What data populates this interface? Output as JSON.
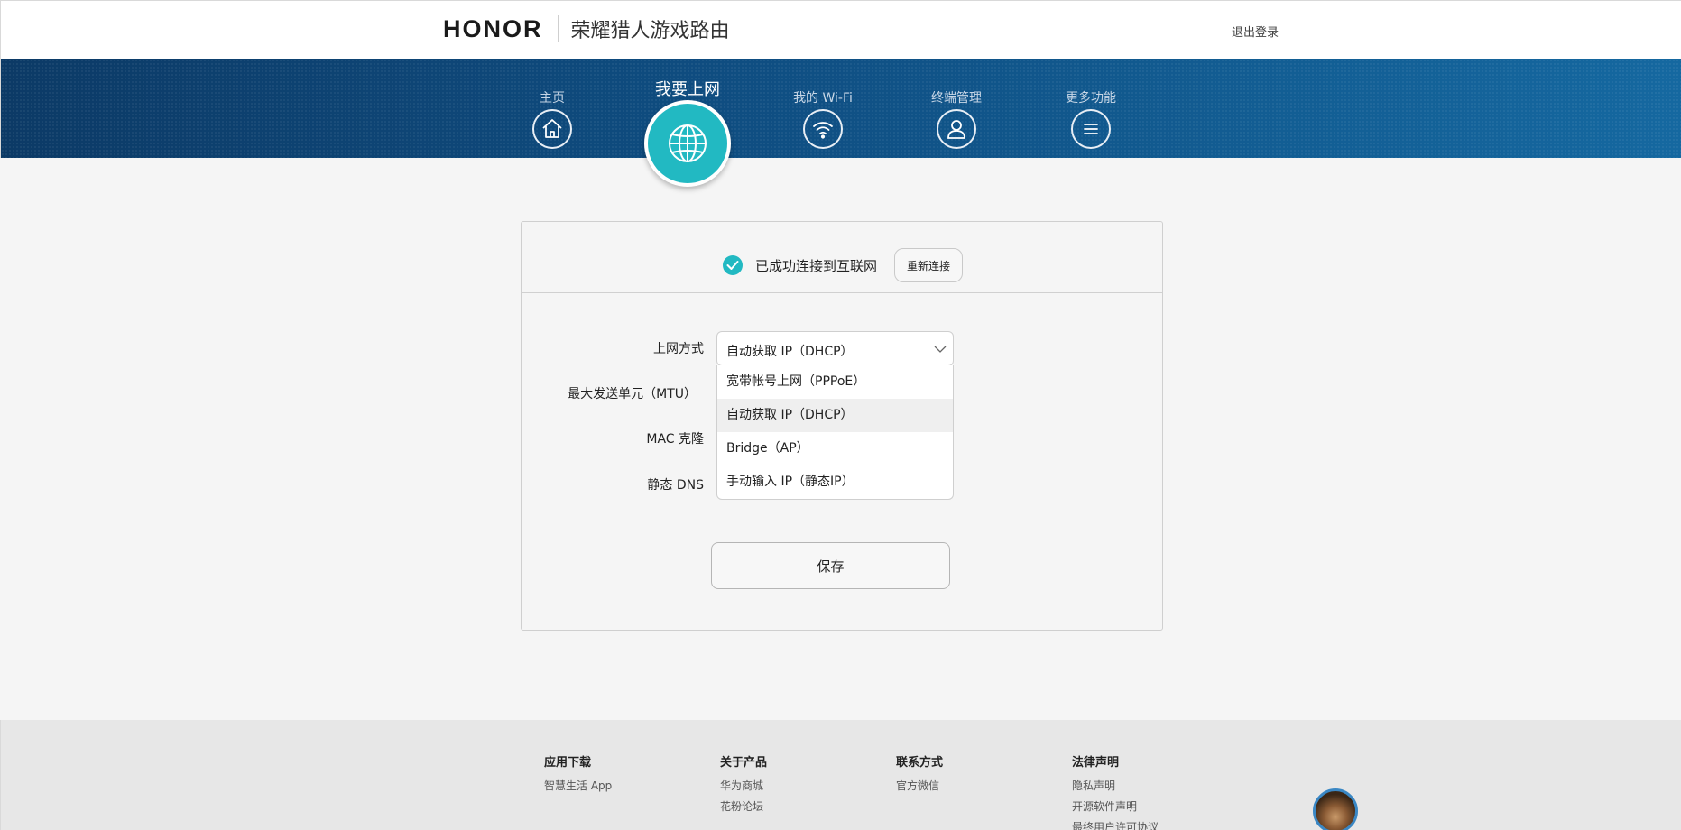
{
  "header": {
    "logo": "HONOR",
    "product_name": "荣耀猎人游戏路由",
    "logout": "退出登录"
  },
  "nav": {
    "items": [
      {
        "label": "主页",
        "icon": "home-icon",
        "active": false
      },
      {
        "label": "我要上网",
        "icon": "globe-icon",
        "active": true
      },
      {
        "label": "我的 Wi-Fi",
        "icon": "wifi-icon",
        "active": false
      },
      {
        "label": "终端管理",
        "icon": "user-icon",
        "active": false
      },
      {
        "label": "更多功能",
        "icon": "menu-icon",
        "active": false
      }
    ]
  },
  "status": {
    "text": "已成功连接到互联网",
    "reconnect": "重新连接"
  },
  "form": {
    "connection_type_label": "上网方式",
    "connection_type_value": "自动获取 IP（DHCP）",
    "mtu_label": "最大发送单元（MTU）",
    "mac_clone_label": "MAC 克隆",
    "static_dns_label": "静态 DNS",
    "options": [
      "宽带帐号上网（PPPoE）",
      "自动获取 IP（DHCP）",
      "Bridge（AP）",
      "手动输入 IP（静态IP）"
    ],
    "selected_option": "自动获取 IP（DHCP）",
    "save": "保存"
  },
  "footer": {
    "columns": [
      {
        "title": "应用下载",
        "links": [
          "智慧生活 App"
        ]
      },
      {
        "title": "关于产品",
        "links": [
          "华为商城",
          "花粉论坛"
        ]
      },
      {
        "title": "联系方式",
        "links": [
          "官方微信"
        ]
      },
      {
        "title": "法律声明",
        "links": [
          "隐私声明",
          "开源软件声明",
          "最终用户许可协议"
        ]
      }
    ]
  },
  "colors": {
    "accent": "#22b9c2",
    "nav_band_start": "#0c3a66",
    "nav_band_end": "#1568a0",
    "page_bg": "#f5f5f5",
    "footer_bg": "#e7e7e7"
  }
}
